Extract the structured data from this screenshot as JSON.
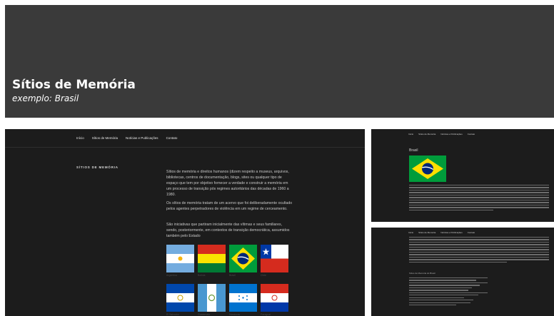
{
  "hero": {
    "title": "Sítios de Memória",
    "subtitle": "exemplo: Brasil",
    "background": "#3a3a3a"
  },
  "main": {
    "nav": [
      "Início",
      "Sítios de Memória",
      "Notícias e Publicações",
      "Contato"
    ],
    "section_heading": "SÍTIOS DE MEMÓRIA",
    "paragraphs": [
      "Sítios de memória e direitos humanos (dizem respeito a museus, arquivos, bibliotecas, centros de documentação, blogs, sites ou qualquer tipo de espaço que tem por objetivo fornecer a verdade e construir a memória em um processo de transição pós regimes autoritários das décadas de 1960 a 1980.",
      "Os sítios de memória tratam de um acervo que foi deliberadamente ocultado pelos agentes perpetradores de violência em um regime de cerceamento.",
      "São iniciativas que partiram inicialmente das vítimas e seus familiares, sendo, posteriormente, em contextos de transição democrática, assumidos também pelo Estado"
    ],
    "flag_captions": [
      "Argentina",
      "Bolívia",
      "Brasil",
      "Chile",
      "El Salvador",
      "Guatemala",
      "Honduras",
      "Paraguai"
    ]
  },
  "side": {
    "nav": [
      "Início",
      "Sítios de Memória",
      "Notícias e Publicações",
      "Contato"
    ],
    "title": "Brasil",
    "list_title": "Sítios de Memória do Brasil"
  },
  "icons": {
    "flags": [
      "argentina-flag-icon",
      "bolivia-flag-icon",
      "brazil-flag-icon",
      "chile-flag-icon",
      "el-salvador-flag-icon",
      "guatemala-flag-icon",
      "honduras-flag-icon",
      "paraguay-flag-icon"
    ]
  },
  "colors": {
    "dark_panel": "#1c1c1c",
    "header_band": "#3a3a3a",
    "text_light": "#ffffff"
  }
}
